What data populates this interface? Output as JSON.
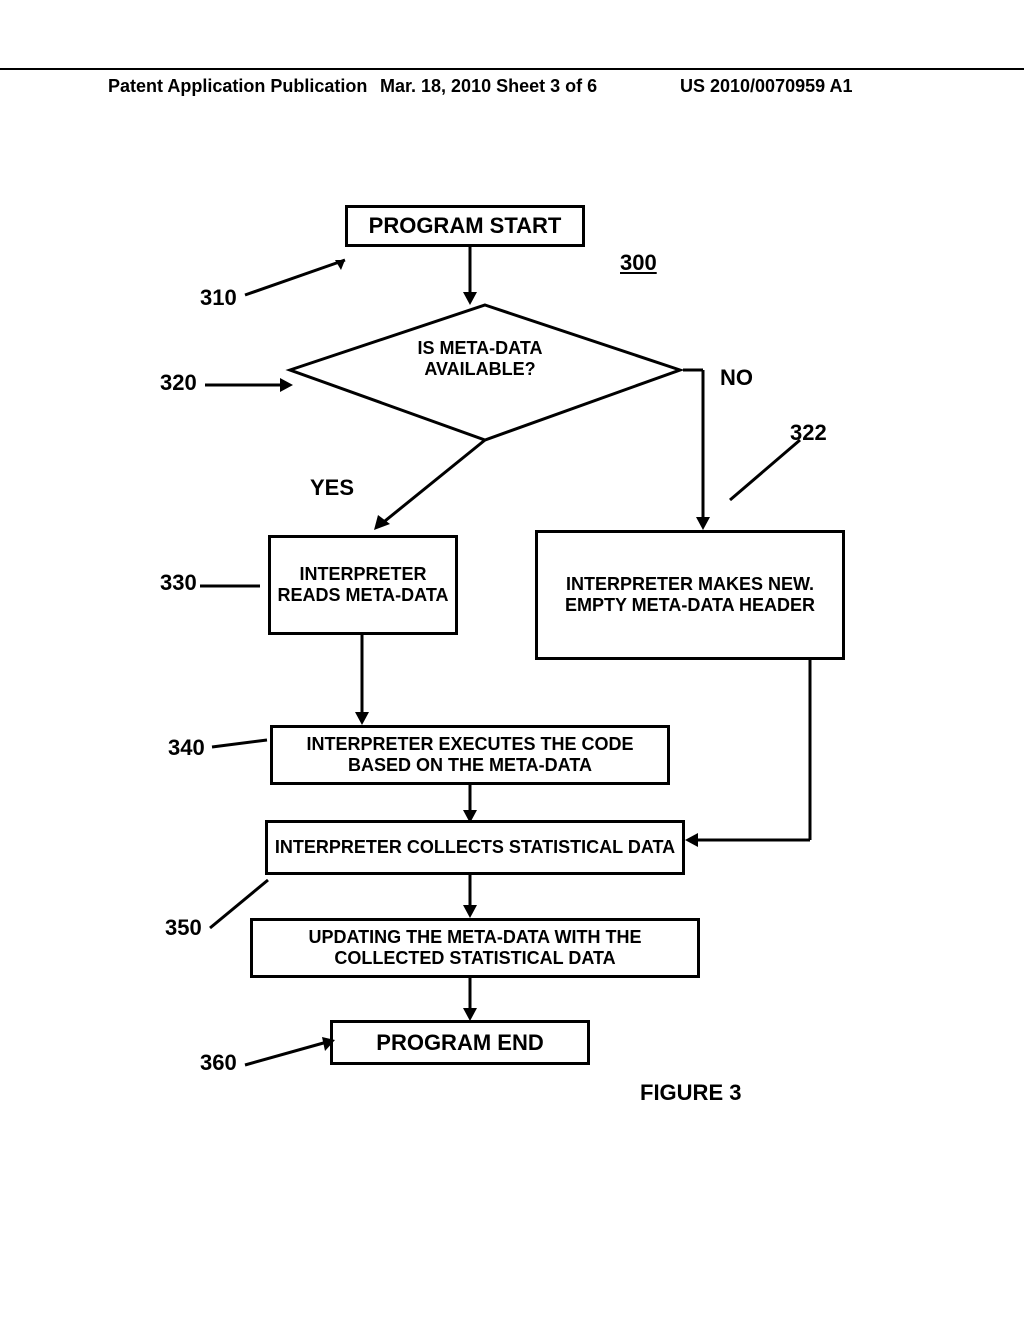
{
  "header": {
    "left": "Patent Application Publication",
    "mid": "Mar. 18, 2010  Sheet 3 of 6",
    "right": "US 2010/0070959 A1"
  },
  "refs": {
    "r300": "300",
    "r310": "310",
    "r320": "320",
    "r322": "322",
    "r330": "330",
    "r340": "340",
    "r350": "350",
    "r360": "360"
  },
  "nodes": {
    "start": "PROGRAM START",
    "decision": "IS META-DATA AVAILABLE?",
    "yes": "YES",
    "no": "NO",
    "readMeta": "INTERPRETER READS META-DATA",
    "makeHeader": "INTERPRETER MAKES NEW. EMPTY META-DATA HEADER",
    "execute": "INTERPRETER EXECUTES THE CODE BASED ON THE META-DATA",
    "collect": "INTERPRETER COLLECTS STATISTICAL DATA",
    "update": "UPDATING THE META-DATA WITH THE COLLECTED STATISTICAL DATA",
    "end": "PROGRAM END"
  },
  "caption": "FIGURE 3"
}
